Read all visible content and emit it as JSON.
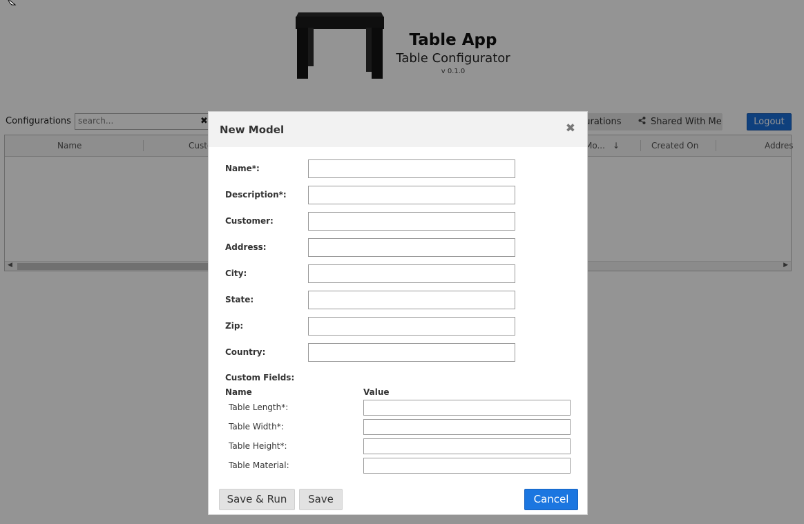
{
  "header": {
    "app_title": "Table App",
    "app_subtitle": "Table Configurator",
    "version": "v 0.1.0"
  },
  "toolbar": {
    "label": "Configurations",
    "search_placeholder": "search...",
    "clear_icon": "close-icon",
    "tab_configurations": "gurations",
    "tab_shared": "Shared With Me",
    "logout": "Logout"
  },
  "grid": {
    "columns": [
      "Name",
      "Custo",
      "Mo...",
      "Created On",
      "Addres"
    ]
  },
  "modal": {
    "title": "New Model",
    "close_icon": "close-icon",
    "fields": [
      {
        "label": "Name*:",
        "value": ""
      },
      {
        "label": "Description*:",
        "value": ""
      },
      {
        "label": "Customer:",
        "value": ""
      },
      {
        "label": "Address:",
        "value": ""
      },
      {
        "label": "City:",
        "value": ""
      },
      {
        "label": "State:",
        "value": ""
      },
      {
        "label": "Zip:",
        "value": ""
      },
      {
        "label": "Country:",
        "value": ""
      }
    ],
    "custom_fields": {
      "title": "Custom Fields:",
      "name_header": "Name",
      "value_header": "Value",
      "rows": [
        {
          "label": "Table Length*:",
          "value": ""
        },
        {
          "label": "Table Width*:",
          "value": ""
        },
        {
          "label": "Table Height*:",
          "value": ""
        },
        {
          "label": "Table Material:",
          "value": ""
        }
      ]
    },
    "buttons": {
      "save_run": "Save & Run",
      "save": "Save",
      "cancel": "Cancel"
    }
  },
  "colors": {
    "primary": "#1b76e0",
    "overlay": "rgba(0,0,0,0.42)"
  }
}
